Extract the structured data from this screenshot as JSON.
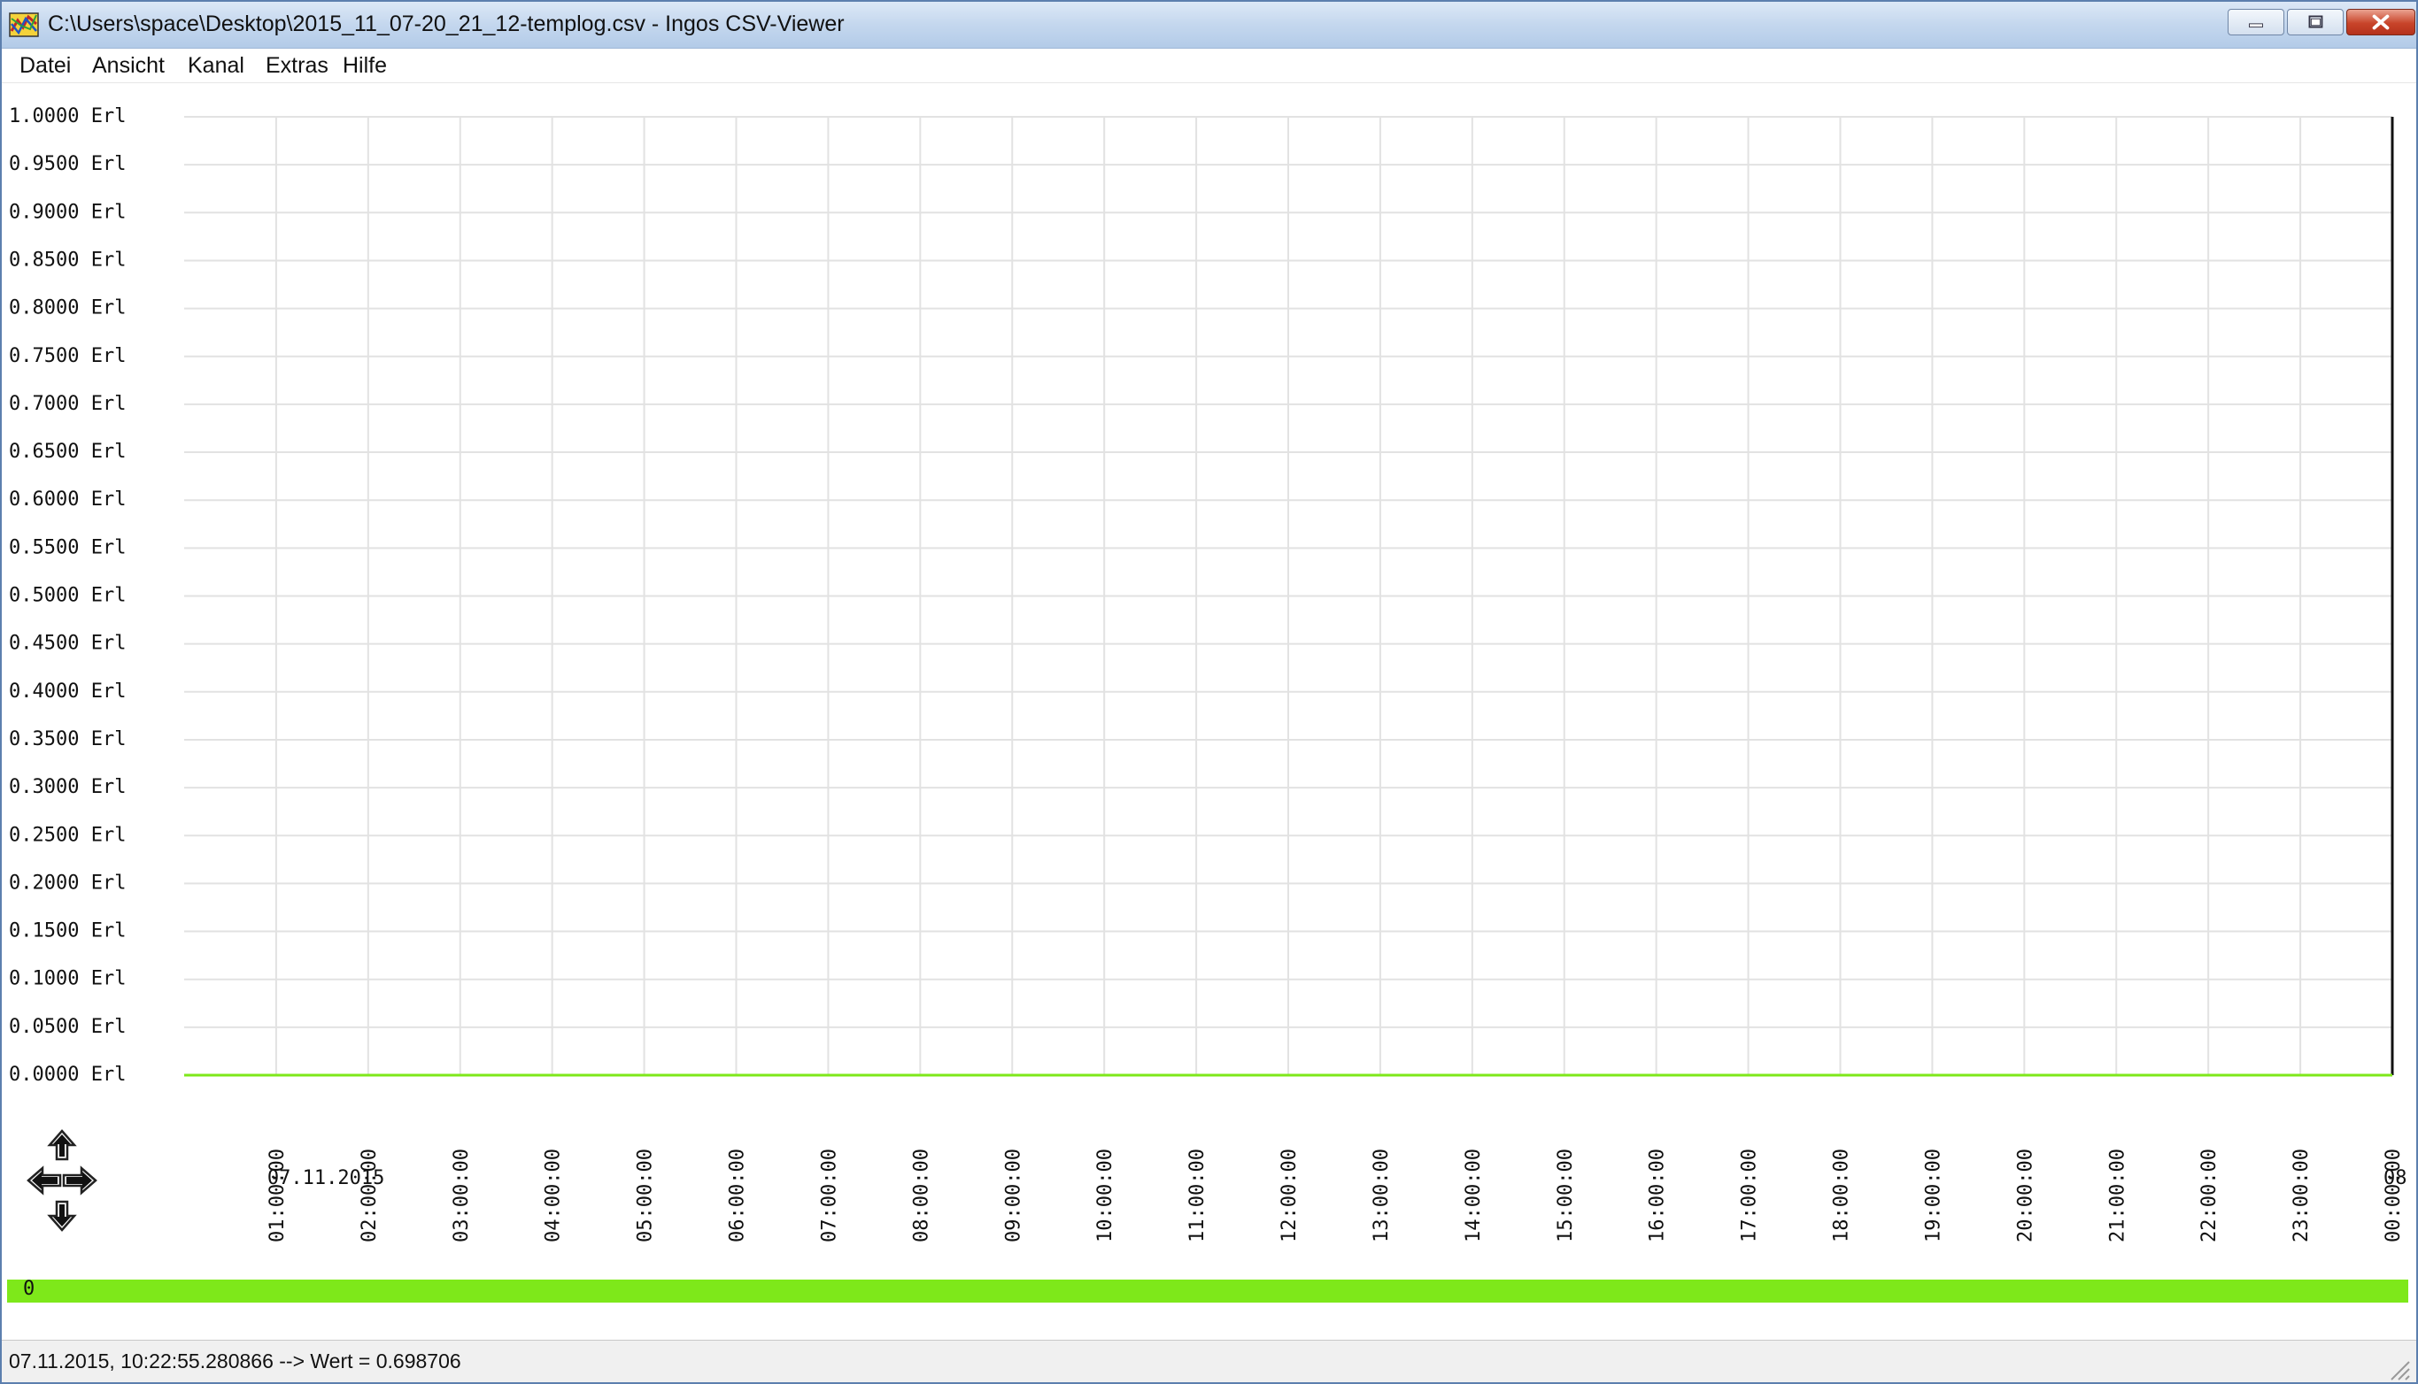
{
  "window": {
    "title": "C:\\Users\\space\\Desktop\\2015_11_07-20_21_12-templog.csv - Ingos CSV-Viewer"
  },
  "menu": {
    "items": [
      "Datei",
      "Ansicht",
      "Kanal",
      "Extras",
      "Hilfe"
    ]
  },
  "chart_data": {
    "type": "line",
    "y_unit": "Erl",
    "ylim": [
      0,
      1
    ],
    "y_ticks": [
      "1.0000 Erl",
      "0.9500 Erl",
      "0.9000 Erl",
      "0.8500 Erl",
      "0.8000 Erl",
      "0.7500 Erl",
      "0.7000 Erl",
      "0.6500 Erl",
      "0.6000 Erl",
      "0.5500 Erl",
      "0.5000 Erl",
      "0.4500 Erl",
      "0.4000 Erl",
      "0.3500 Erl",
      "0.3000 Erl",
      "0.2500 Erl",
      "0.2000 Erl",
      "0.1500 Erl",
      "0.1000 Erl",
      "0.0500 Erl",
      "0.0000 Erl"
    ],
    "x_ticks": [
      "01:00:00",
      "02:00:00",
      "03:00:00",
      "04:00:00",
      "05:00:00",
      "06:00:00",
      "07:00:00",
      "08:00:00",
      "09:00:00",
      "10:00:00",
      "11:00:00",
      "12:00:00",
      "13:00:00",
      "14:00:00",
      "15:00:00",
      "16:00:00",
      "17:00:00",
      "18:00:00",
      "19:00:00",
      "20:00:00",
      "21:00:00",
      "22:00:00",
      "23:00:00",
      "00:00:00"
    ],
    "date_labels": [
      "07.11.2015",
      "08"
    ],
    "grid": true,
    "series": [
      {
        "color": "#7ee81a",
        "x": [
          "00:00:00",
          "24:00:00"
        ],
        "y": [
          0,
          0
        ]
      }
    ]
  },
  "channel": {
    "label": "0",
    "color": "#7ee81a"
  },
  "status": {
    "text": "07.11.2015, 10:22:55.280866 --> Wert = 0.698706"
  },
  "icons": {
    "app": "app-icon",
    "nav": [
      "arrow-up-icon",
      "arrow-left-icon",
      "arrow-right-icon",
      "arrow-down-icon"
    ]
  }
}
